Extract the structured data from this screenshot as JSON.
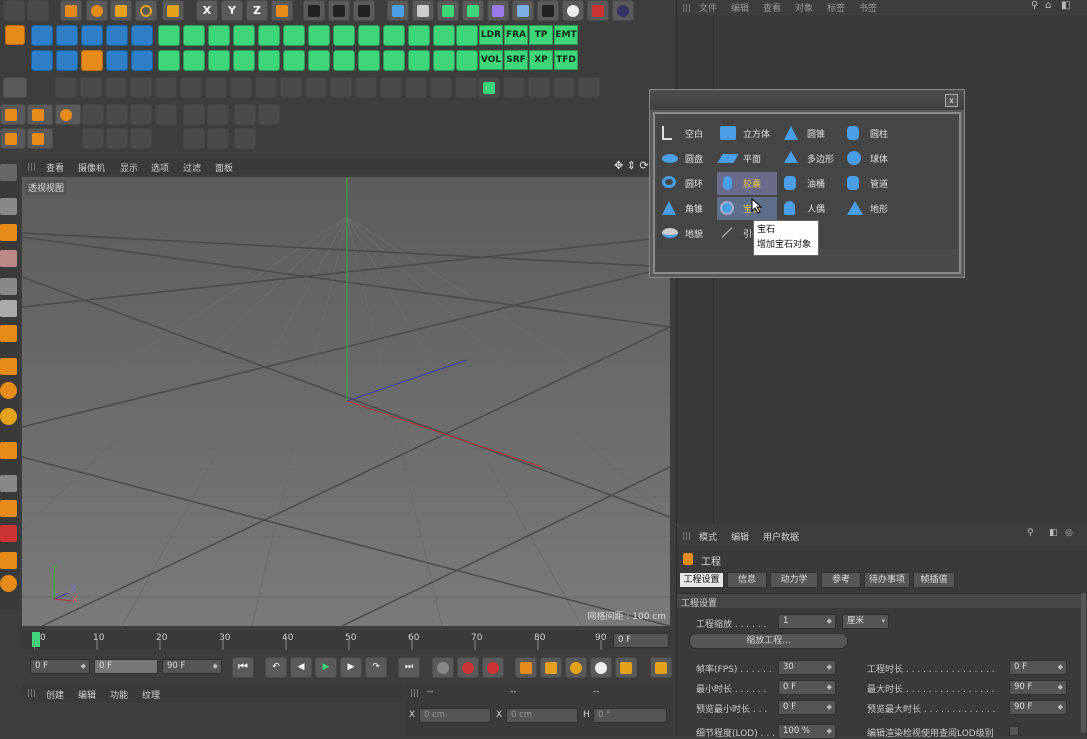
{
  "top_toolbar": {
    "axis_x": "X",
    "axis_y": "Y",
    "axis_z": "Z",
    "text_buttons": [
      "LDR",
      "FRA",
      "TP",
      "EMT",
      "VOL",
      "SRF",
      "XP",
      "TFD"
    ]
  },
  "right_menu": {
    "items": [
      "文件",
      "编辑",
      "查看",
      "对象",
      "标签",
      "书签"
    ]
  },
  "viewport": {
    "menu": [
      "查看",
      "摄像机",
      "显示",
      "选项",
      "过滤",
      "面板"
    ],
    "label": "透视视图",
    "grid_info": "网格间距 : 100 cm",
    "axis_y": "Y",
    "axis_z": "Z",
    "axis_x": "X"
  },
  "palette": {
    "close": "x",
    "items": [
      {
        "label": "空白",
        "icon": "null-icon"
      },
      {
        "label": "立方体",
        "icon": "cube-icon"
      },
      {
        "label": "圆锥",
        "icon": "cone-icon"
      },
      {
        "label": "圆柱",
        "icon": "cylinder-icon"
      },
      {
        "label": "圆盘",
        "icon": "disc-icon"
      },
      {
        "label": "平面",
        "icon": "plane-icon"
      },
      {
        "label": "多边形",
        "icon": "polygon-icon"
      },
      {
        "label": "球体",
        "icon": "sphere-icon"
      },
      {
        "label": "圆环",
        "icon": "torus-icon"
      },
      {
        "label": "胶囊",
        "icon": "capsule-icon"
      },
      {
        "label": "油桶",
        "icon": "oiltank-icon"
      },
      {
        "label": "管道",
        "icon": "tube-icon"
      },
      {
        "label": "角锥",
        "icon": "pyramid-icon"
      },
      {
        "label": "宝石",
        "icon": "gem-icon"
      },
      {
        "label": "人偶",
        "icon": "figure-icon"
      },
      {
        "label": "地形",
        "icon": "landscape-icon"
      },
      {
        "label": "地貌",
        "icon": "relief-icon"
      },
      {
        "label": "引导线",
        "icon": "guide-icon"
      }
    ],
    "tooltip_title": "宝石",
    "tooltip_desc": "增加宝石对象"
  },
  "timeline": {
    "ticks": [
      "0",
      "10",
      "20",
      "30",
      "40",
      "50",
      "60",
      "70",
      "80",
      "90"
    ],
    "current_frame": "0 F",
    "start_field": "0 F",
    "preview_min": "0 F",
    "preview_max": "90 F",
    "end_field": "90 F"
  },
  "material_menu": {
    "items": [
      "创建",
      "编辑",
      "功能",
      "纹理"
    ]
  },
  "coords": {
    "headers": [
      "--",
      "--",
      "--"
    ],
    "x_label": "X",
    "x_val": "0 cm",
    "x2_label": "X",
    "x2_val": "0 cm",
    "h_label": "H",
    "h_val": "0 °"
  },
  "attributes": {
    "menu": [
      "模式",
      "编辑",
      "用户数据"
    ],
    "title": "工程",
    "tabs": [
      "工程设置",
      "信息",
      "动力学",
      "参考",
      "待办事项",
      "帧插值"
    ],
    "section": "工程设置",
    "scale_label": "工程缩放 . . . . . .",
    "scale_value": "1",
    "scale_unit": "厘米",
    "scale_button": "缩放工程...",
    "fps_label": "帧率(FPS) . . . . . .",
    "fps_value": "30",
    "duration_label": "工程时长 . . . . . . . . . . . . . . . .",
    "duration_value": "0 F",
    "min_label": "最小时长 . . . . . .",
    "min_value": "0 F",
    "max_label": "最大时长 . . . . . . . . . . . . . . . .",
    "max_value": "90 F",
    "pmin_label": "预览最小时长 . . .",
    "pmin_value": "0 F",
    "pmax_label": "预览最大时长 . . . . . . . . . . . . .",
    "pmax_value": "90 F",
    "lod_label": "细节程度(LOD) . . .",
    "lod_value": "100 %",
    "lod_check_label": "编辑渲染检视使用查阅LOD级别"
  }
}
